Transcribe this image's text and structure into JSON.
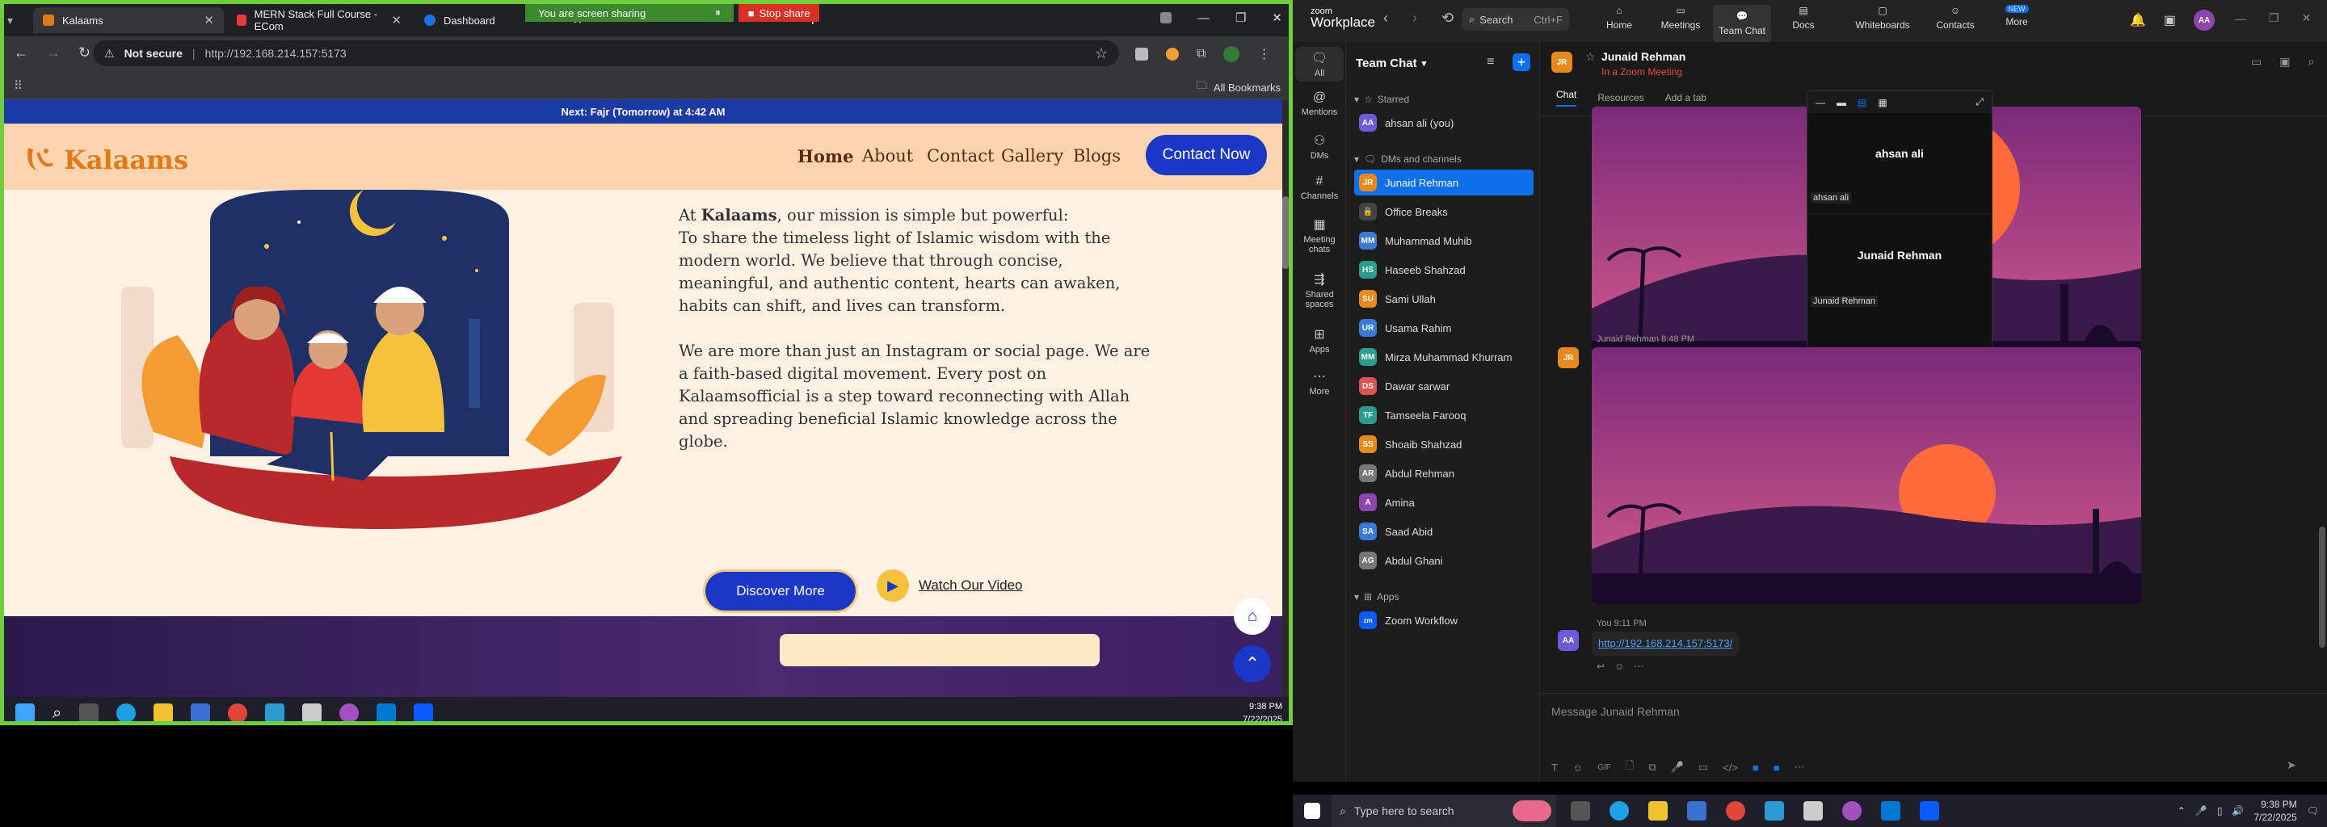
{
  "browser": {
    "tabs": [
      {
        "label": "Kalaams",
        "color": "#e07a16"
      },
      {
        "label": "MERN Stack Full Course - ECom",
        "color": "#e53935"
      },
      {
        "label": "Dashboard",
        "color": "#1a73e8"
      }
    ],
    "share_status": "You are screen sharing",
    "stop_share": "Stop share",
    "not_secure": "Not secure",
    "url": "http://192.168.214.157:5173",
    "all_bookmarks": "All Bookmarks"
  },
  "site": {
    "prayer": "Next: Fajr (Tomorrow) at 4:42 AM",
    "logo": "Kalaams",
    "nav": [
      "Home",
      "About",
      "Contact",
      "Gallery",
      "Blogs"
    ],
    "cta": "Contact Now",
    "mission_pre": "At ",
    "mission_brand": "Kalaams",
    "mission_post": ", our mission is simple but powerful:",
    "para1": "To share the timeless light of Islamic wisdom with the modern world. We believe that through concise, meaningful, and authentic content, hearts can awaken, habits can shift, and lives can transform.",
    "para2": "We are more than just an Instagram or social page. We are a faith-based digital movement. Every post on Kalaamsofficial is a step toward reconnecting with Allah and spreading beneficial Islamic knowledge across the globe.",
    "discover": "Discover More",
    "watch": "Watch Our Video"
  },
  "taskbar_left": {
    "time": "9:38 PM",
    "date": "7/22/2025"
  },
  "zoom": {
    "brand_top": "zoom",
    "brand": "Workplace",
    "search": "Search",
    "search_shortcut": "Ctrl+F",
    "nav": [
      "Home",
      "Meetings",
      "Team Chat",
      "Docs",
      "Whiteboards",
      "Contacts",
      "More"
    ],
    "new_badge": "NEW",
    "rail": [
      "All",
      "Mentions",
      "DMs",
      "Channels",
      "Meeting chats",
      "Shared spaces",
      "Apps",
      "More"
    ],
    "list_title": "Team Chat",
    "starred_label": "Starred",
    "starred": [
      {
        "name": "ahsan ali (you)",
        "ini": "AA",
        "color": "#6b5bd6"
      }
    ],
    "dm_label": "DMs and channels",
    "dms": [
      {
        "name": "Junaid Rehman",
        "ini": "JR",
        "color": "#e8891d"
      },
      {
        "name": "Office Breaks",
        "ini": "🔒",
        "color": "#444"
      },
      {
        "name": "Muhammad Muhib",
        "ini": "MM",
        "color": "#3a7bd5"
      },
      {
        "name": "Haseeb Shahzad",
        "ini": "HS",
        "color": "#2a9d8f"
      },
      {
        "name": "Sami Ullah",
        "ini": "SU",
        "color": "#e8891d"
      },
      {
        "name": "Usama Rahim",
        "ini": "UR",
        "color": "#3a7bd5"
      },
      {
        "name": "Mirza Muhammad Khurram",
        "ini": "MM",
        "color": "#2a9d8f"
      },
      {
        "name": "Dawar sarwar",
        "ini": "DS",
        "color": "#d9534f"
      },
      {
        "name": "Tamseela Farooq",
        "ini": "TF",
        "color": "#2a9d8f"
      },
      {
        "name": "Shoaib Shahzad",
        "ini": "SS",
        "color": "#e8891d"
      },
      {
        "name": "Abdul Rehman",
        "ini": "AR",
        "color": "#777"
      },
      {
        "name": "Amina",
        "ini": "A",
        "color": "#8e44ad"
      },
      {
        "name": "Saad Abid",
        "ini": "SA",
        "color": "#3a7bd5"
      },
      {
        "name": "Abdul Ghani",
        "ini": "AG",
        "color": "#777"
      }
    ],
    "apps_label": "Apps",
    "app": "Zoom Workflow",
    "chat_name": "Junaid Rehman",
    "chat_status": "In a Zoom Meeting",
    "chat_tabs": [
      "Chat",
      "Resources",
      "Add a tab"
    ],
    "msg_sender": "Junaid Rehman 8:48 PM",
    "you_meta": "You 9:11 PM",
    "link": "http://192.168.214.157:5173/",
    "composer": "Message Junaid Rehman",
    "video": {
      "p1": "ahsan ali",
      "p1_small": "ahsan ali",
      "p2": "Junaid Rehman",
      "p2_small": "Junaid Rehman"
    }
  },
  "taskbar_right": {
    "search": "Type here to search",
    "time": "9:38 PM",
    "date": "7/22/2025"
  }
}
